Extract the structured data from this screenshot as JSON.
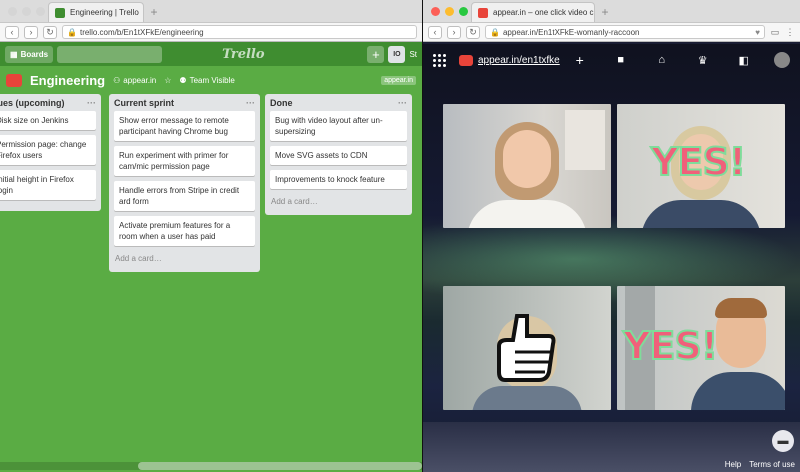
{
  "trello_window": {
    "tab_title": "Engineering | Trello",
    "url": "trello.com/b/En1tXFkE/engineering",
    "nav": {
      "boards_label": "Boards",
      "logo": "Trello",
      "avatar_initials": "IO",
      "user_label": "St"
    },
    "board": {
      "title": "Engineering",
      "integration": "appear.in",
      "visibility": "Team Visible",
      "badge": "appear.in"
    },
    "lists": [
      {
        "title": "Issues (upcoming)",
        "cards": [
          "Disk size on Jenkins",
          "Permission page: change Firefox users",
          "Initial height in Firefox login"
        ]
      },
      {
        "title": "Current sprint",
        "cards": [
          "Show error message to remote participant having Chrome bug",
          "Run experiment with primer for cam/mic permission page",
          "Handle errors from Stripe in credit ard form",
          "Activate premium features for a room when a user has paid"
        ],
        "add": "Add a card…"
      },
      {
        "title": "Done",
        "cards": [
          "Bug with video layout after un-supersizing",
          "Move SVG assets to CDN",
          "Improvements to knock feature"
        ],
        "add": "Add a card…"
      }
    ]
  },
  "appear_window": {
    "tab_title": "appear.in – one click video c",
    "url": "appear.in/En1tXFkE-womanly-raccoon",
    "room_link": "appear.in/en1txfke",
    "yes_text": "YES!",
    "footer": {
      "help": "Help",
      "terms": "Terms of use"
    }
  },
  "colors": {
    "trello_green": "#5aac44",
    "appear_red": "#e8443a"
  }
}
